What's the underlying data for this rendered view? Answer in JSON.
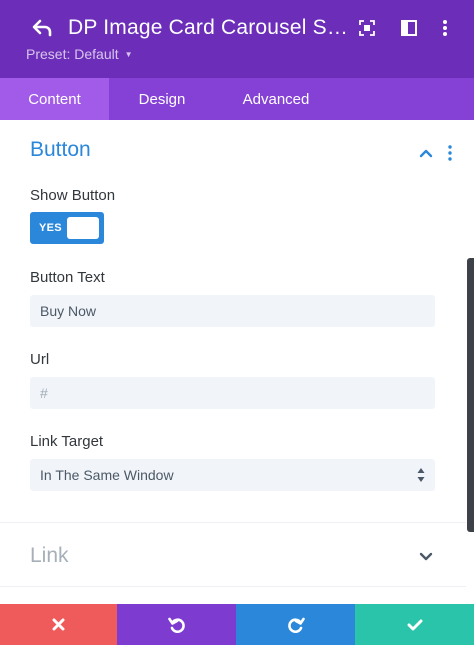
{
  "header": {
    "title": "DP Image Card Carousel Settings",
    "preset_label": "Preset: Default",
    "icons": [
      "back-arrow-icon",
      "expand-icon",
      "split-view-icon",
      "more-vertical-icon"
    ]
  },
  "tabs": [
    {
      "label": "Content",
      "active": true
    },
    {
      "label": "Design",
      "active": false
    },
    {
      "label": "Advanced",
      "active": false
    }
  ],
  "section_button": {
    "title": "Button",
    "show_button": {
      "label": "Show Button",
      "toggle_text": "YES",
      "on": true
    },
    "button_text": {
      "label": "Button Text",
      "value": "Buy Now"
    },
    "url": {
      "label": "Url",
      "placeholder": "#",
      "value": ""
    },
    "link_target": {
      "label": "Link Target",
      "selected": "In The Same Window"
    }
  },
  "section_link": {
    "title": "Link"
  },
  "footer": {
    "actions": [
      "cancel",
      "undo",
      "redo",
      "save"
    ]
  },
  "colors": {
    "header_bg": "#6c2eb9",
    "tabs_bg": "#8540d6",
    "tab_active_bg": "#a25ae9",
    "accent_blue": "#2b87da",
    "cancel": "#ef5a5a",
    "undo": "#7e3bd0",
    "redo": "#2b87da",
    "save": "#29c4a9"
  }
}
